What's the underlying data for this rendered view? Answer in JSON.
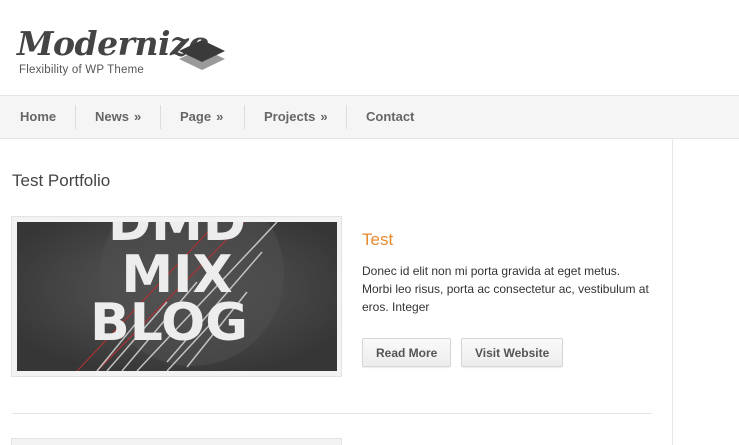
{
  "site": {
    "logo_title": "Modernize",
    "tagline": "Flexibility of WP Theme"
  },
  "nav": {
    "items": [
      {
        "label": "Home",
        "has_submenu": false
      },
      {
        "label": "News",
        "has_submenu": true
      },
      {
        "label": "Page",
        "has_submenu": true
      },
      {
        "label": "Projects",
        "has_submenu": true
      },
      {
        "label": "Contact",
        "has_submenu": false
      }
    ],
    "submenu_indicator": "»"
  },
  "main": {
    "page_title": "Test Portfolio",
    "portfolio_item": {
      "thumbnail_text": [
        "DMD",
        "MIX",
        "BLOG"
      ],
      "title": "Test",
      "excerpt": "Donec id elit non mi porta gravida at eget metus. Morbi leo risus, porta ac consectetur ac, vestibulum at eros. Integer",
      "read_more_label": "Read More",
      "visit_website_label": "Visit Website"
    }
  },
  "colors": {
    "accent": "#e58a2e",
    "nav_bg": "#f5f5f5",
    "text": "#333333"
  }
}
